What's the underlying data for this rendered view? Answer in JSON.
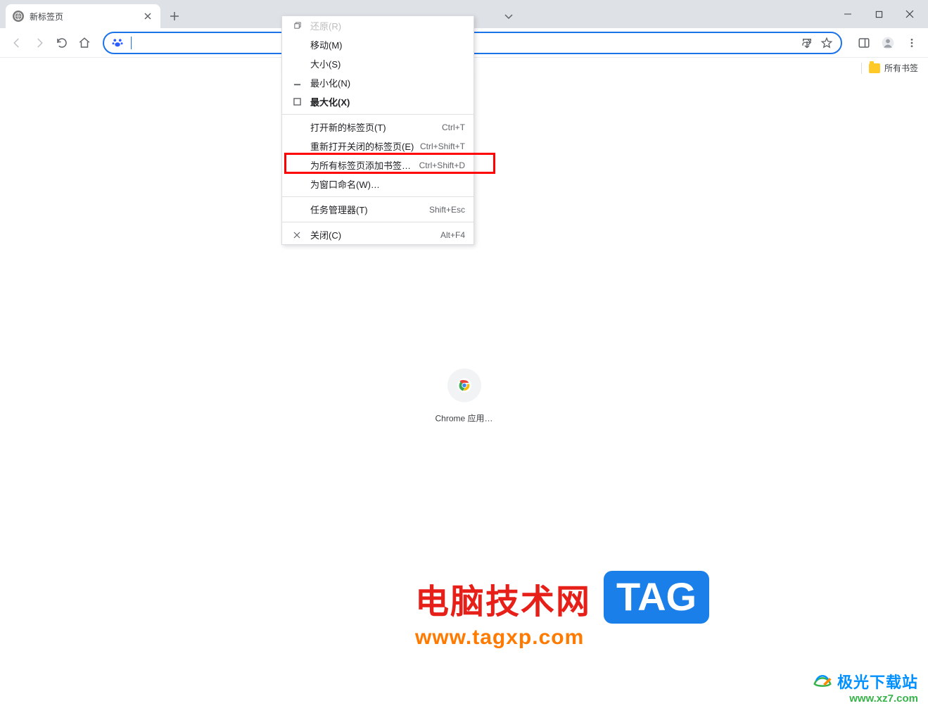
{
  "tab": {
    "title": "新标签页"
  },
  "bookmarks": {
    "all": "所有书签"
  },
  "shortcut": {
    "label": "Chrome 应用…"
  },
  "menu": {
    "restore": "还原(R)",
    "move": "移动(M)",
    "size": "大小(S)",
    "minimize": "最小化(N)",
    "maximize": "最大化(X)",
    "new_tab": "打开新的标签页(T)",
    "new_tab_sc": "Ctrl+T",
    "reopen": "重新打开关闭的标签页(E)",
    "reopen_sc": "Ctrl+Shift+T",
    "bookmark_all": "为所有标签页添加书签…",
    "bookmark_all_sc": "Ctrl+Shift+D",
    "name_window": "为窗口命名(W)…",
    "task_manager": "任务管理器(T)",
    "task_manager_sc": "Shift+Esc",
    "close": "关闭(C)",
    "close_sc": "Alt+F4"
  },
  "watermark1": {
    "title": "电脑技术网",
    "url": "www.tagxp.com",
    "tag": "TAG"
  },
  "watermark2": {
    "name": "极光下载站",
    "url": "www.xz7.com"
  }
}
